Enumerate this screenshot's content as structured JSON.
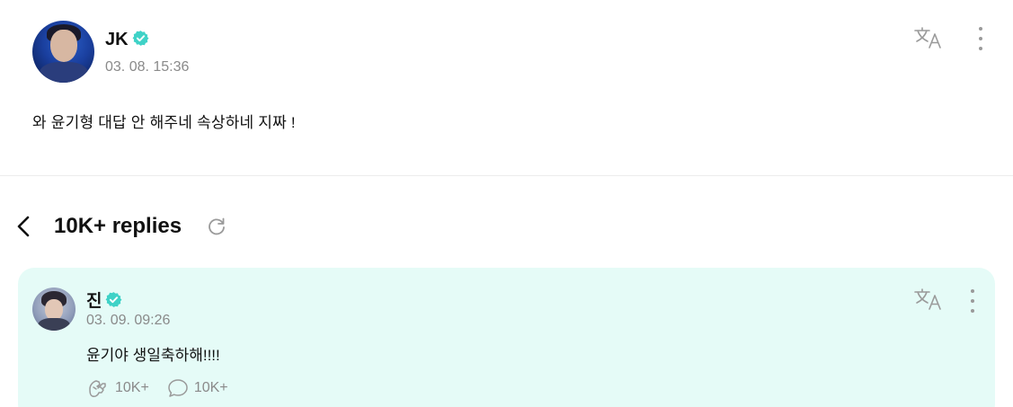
{
  "post": {
    "author": "JK",
    "date": "03. 08. 15:36",
    "body": "와 윤기형 대답 안 해주네 속상하네 지짜 !"
  },
  "replies": {
    "title": "10K+ replies"
  },
  "reply": {
    "author": "진",
    "date": "03. 09. 09:26",
    "body": "윤기야 생일축하해!!!!",
    "likes": "10K+",
    "comments": "10K+"
  },
  "icons": {
    "verified": "verified-badge-icon",
    "translate": "translate-icon",
    "more": "more-vertical-icon",
    "back": "chevron-left-icon",
    "refresh": "refresh-icon",
    "like": "cheer-hands-icon",
    "comment": "comment-bubble-icon"
  },
  "colors": {
    "verified": "#3fd2c7",
    "reply_background": "#e5fbf7",
    "muted_text": "#8a8a8a"
  }
}
